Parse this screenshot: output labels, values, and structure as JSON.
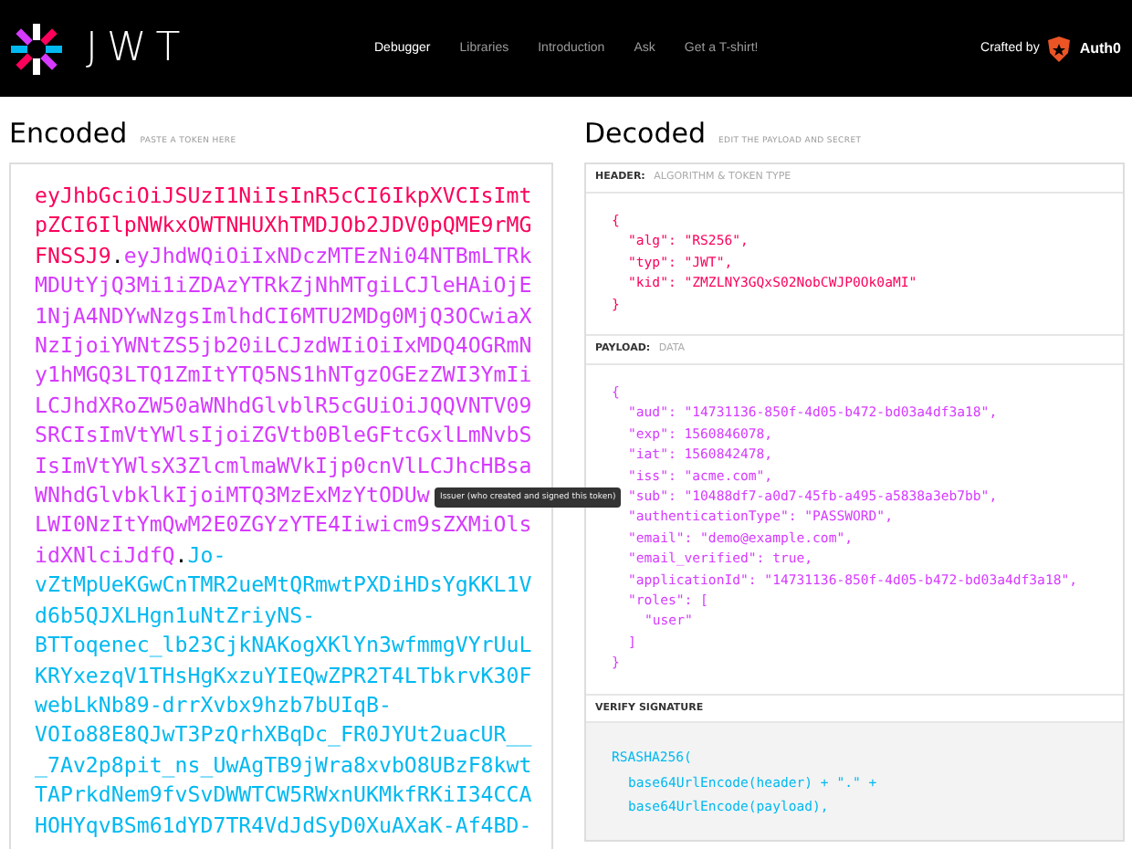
{
  "brand": {
    "wordmark": "JWT"
  },
  "nav": [
    {
      "label": "Debugger",
      "selected": true
    },
    {
      "label": "Libraries",
      "selected": false
    },
    {
      "label": "Introduction",
      "selected": false
    },
    {
      "label": "Ask",
      "selected": false
    },
    {
      "label": "Get a T-shirt!",
      "selected": false
    }
  ],
  "crafted": {
    "label": "Crafted by",
    "company": "Auth0"
  },
  "encoded": {
    "title": "Encoded",
    "subtitle": "PASTE A TOKEN HERE",
    "lines": [
      [
        {
          "kind": "header",
          "text": "eyJhbGciOiJSUzI1NiIsInR5cCI6IkpXVCIsImt"
        }
      ],
      [
        {
          "kind": "header",
          "text": "pZCI6IlpNWkxOWTNHUXhTMDJOb2JDV0pQME9rMG"
        }
      ],
      [
        {
          "kind": "header",
          "text": "FNSSJ9"
        },
        {
          "kind": "dot",
          "text": "."
        },
        {
          "kind": "payload",
          "text": "eyJhdWQiOiIxNDczMTEzNi04NTBmLTRk"
        }
      ],
      [
        {
          "kind": "payload",
          "text": "MDUtYjQ3Mi1iZDAzYTRkZjNhMTgiLCJleHAiOjE"
        }
      ],
      [
        {
          "kind": "payload",
          "text": "1NjA4NDYwNzgsImlhdCI6MTU2MDg0MjQ3OCwiaX"
        }
      ],
      [
        {
          "kind": "payload",
          "text": "NzIjoiYWNtZS5jb20iLCJzdWIiOiIxMDQ4OGRmN"
        }
      ],
      [
        {
          "kind": "payload",
          "text": "y1hMGQ3LTQ1ZmItYTQ5NS1hNTgzOGEzZWI3YmIi"
        }
      ],
      [
        {
          "kind": "payload",
          "text": "LCJhdXRoZW50aWNhdGlvblR5cGUiOiJQQVNTV09"
        }
      ],
      [
        {
          "kind": "payload",
          "text": "SRCIsImVtYWlsIjoiZGVtb0BleGFtcGxlLmNvbS"
        }
      ],
      [
        {
          "kind": "payload",
          "text": "IsImVtYWlsX3ZlcmlmaWVkIjp0cnVlLCJhcHBsa"
        }
      ],
      [
        {
          "kind": "payload",
          "text": "WNhdGlvbklkIjoiMTQ3MzExMzYtODUw"
        }
      ],
      [
        {
          "kind": "payload",
          "text": "LWI0NzItYmQwM2E0ZGYzYTE4Iiwicm9sZXMiOls"
        }
      ],
      [
        {
          "kind": "payload",
          "text": "idXNlciJdfQ"
        },
        {
          "kind": "dot",
          "text": "."
        },
        {
          "kind": "signature",
          "text": "Jo-"
        }
      ],
      [
        {
          "kind": "signature",
          "text": "vZtMpUeKGwCnTMR2ueMtQRmwtPXDiHDsYgKKL1V"
        }
      ],
      [
        {
          "kind": "signature",
          "text": "d6b5QJXLHgn1uNtZriyNS-"
        }
      ],
      [
        {
          "kind": "signature",
          "text": "BTToqenec_lb23CjkNAKogXKlYn3wfmmgVYrUuL"
        }
      ],
      [
        {
          "kind": "signature",
          "text": "KRYxezqV1THsHgKxzuYIEQwZPR2T4LTbkrvK30F"
        }
      ],
      [
        {
          "kind": "signature",
          "text": "webLkNb89-drrXvbx9hzb7bUIqB-"
        }
      ],
      [
        {
          "kind": "signature",
          "text": "VOIo88E8QJwT3PzQrhXBqDc_FR0JYUt2uacUR__"
        }
      ],
      [
        {
          "kind": "signature",
          "text": "_7Av2p8pit_ns_UwAgTB9jWra8xvbO8UBzF8kwt"
        }
      ],
      [
        {
          "kind": "signature",
          "text": "TAPrkdNem9fvSvDWWTCW5RWxnUKMkfRKiI34CCA"
        }
      ],
      [
        {
          "kind": "signature",
          "text": "HOHYqvBSm61dYD7TR4VdJdSyD0XuAXaK-Af4BD-"
        }
      ]
    ],
    "tooltip": "Issuer (who created and signed this token)"
  },
  "decoded": {
    "title": "Decoded",
    "subtitle": "EDIT THE PAYLOAD AND SECRET",
    "panels": [
      {
        "kind": "header",
        "label": "HEADER:",
        "sublabel": "ALGORITHM & TOKEN TYPE",
        "lines": [
          {
            "text": "{",
            "children": [
              {
                "text": "\"alg\": \"RS256\","
              },
              {
                "text": "\"typ\": \"JWT\","
              },
              {
                "text": "\"kid\": \"ZMZLNY3GQxS02NobCWJP0Ok0aMI\""
              }
            ]
          },
          {
            "text": "}"
          }
        ]
      },
      {
        "kind": "payload",
        "label": "PAYLOAD:",
        "sublabel": "DATA",
        "lines": [
          {
            "text": "{",
            "children": [
              {
                "text": "\"aud\": \"14731136-850f-4d05-b472-bd03a4df3a18\","
              },
              {
                "text": "\"exp\": 1560846078,"
              },
              {
                "text": "\"iat\": 1560842478,"
              },
              {
                "text": "\"iss\": \"acme.com\","
              },
              {
                "text": "\"sub\": \"10488df7-a0d7-45fb-a495-a5838a3eb7bb\","
              },
              {
                "text": "\"authenticationType\": \"PASSWORD\","
              },
              {
                "text": "\"email\": \"demo@example.com\","
              },
              {
                "text": "\"email_verified\": true,"
              },
              {
                "text": "\"applicationId\": \"14731136-850f-4d05-b472-bd03a4df3a18\","
              },
              {
                "text": "\"roles\": [",
                "children": [
                  {
                    "text": "\"user\""
                  }
                ]
              },
              {
                "text": "]"
              }
            ]
          },
          {
            "text": "}"
          }
        ]
      },
      {
        "kind": "signature",
        "label": "VERIFY SIGNATURE",
        "lines": [
          {
            "text": "RSASHA256(",
            "children": [
              {
                "text": "base64UrlEncode(header) + \".\" +"
              },
              {
                "text": "base64UrlEncode(payload),"
              }
            ]
          }
        ]
      }
    ]
  }
}
